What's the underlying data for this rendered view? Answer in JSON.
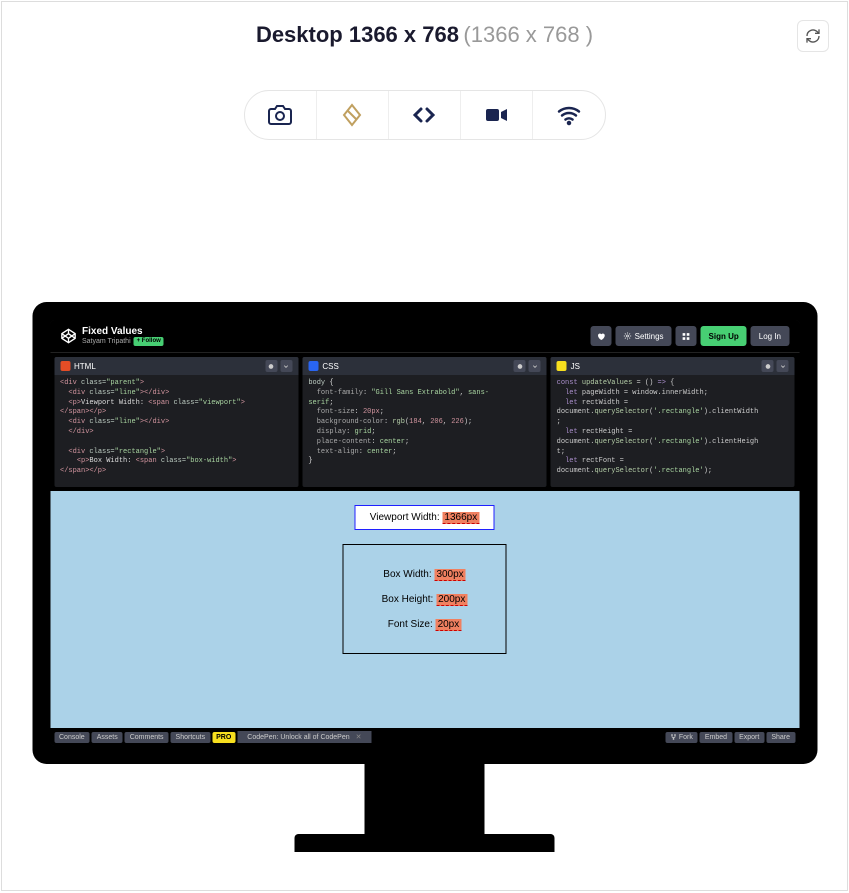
{
  "header": {
    "title_bold": "Desktop 1366 x 768",
    "title_dims": "(1366 x 768 )"
  },
  "toolbar_icons": [
    "camera-icon",
    "rotate-icon",
    "code-icon",
    "video-icon",
    "wifi-icon"
  ],
  "codepen": {
    "title": "Fixed Values",
    "author": "Satyam Tripathi",
    "follow": "+ Follow",
    "buttons": {
      "settings": "Settings",
      "signup": "Sign Up",
      "login": "Log In"
    },
    "panels": {
      "html": {
        "label": "HTML",
        "code_lines": [
          "<div class=\"parent\">",
          "  <div class=\"line\"></div>",
          "  <p>Viewport Width: <span class=\"viewport\">",
          "</span></p>",
          "  <div class=\"line\"></div>",
          "  </div>",
          "",
          "  <div class=\"rectangle\">",
          "    <p>Box Width: <span class=\"box-width\">",
          "</span></p>"
        ]
      },
      "css": {
        "label": "CSS",
        "code_lines": [
          "body {",
          "  font-family: \"Gill Sans Extrabold\", sans-",
          "serif;",
          "  font-size: 20px;",
          "  background-color: rgb(184, 206, 226);",
          "  display: grid;",
          "  place-content: center;",
          "  text-align: center;",
          "}"
        ]
      },
      "js": {
        "label": "JS",
        "code_lines": [
          "const updateValues = () => {",
          "  let pageWidth = window.innerWidth;",
          "  let rectWidth =",
          "document.querySelector('.rectangle').clientWidth",
          ";",
          "  let rectHeight =",
          "document.querySelector('.rectangle').clientHeigh",
          "t;",
          "  let rectFont =",
          "document.querySelector('.rectangle');"
        ]
      }
    },
    "preview": {
      "viewport_label": "Viewport Width: ",
      "viewport_value": "1366px",
      "box_width_label": "Box Width: ",
      "box_width_value": "300px",
      "box_height_label": "Box Height: ",
      "box_height_value": "200px",
      "font_size_label": "Font Size: ",
      "font_size_value": "20px"
    },
    "bottom": {
      "left": [
        "Console",
        "Assets",
        "Comments",
        "Shortcuts"
      ],
      "pro": "PRO",
      "promo": "CodePen: Unlock all of CodePen",
      "right": [
        "Fork",
        "Embed",
        "Export",
        "Share"
      ]
    }
  }
}
